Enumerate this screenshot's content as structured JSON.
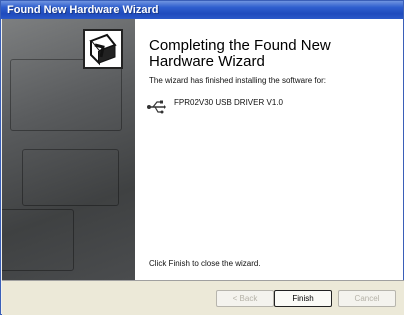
{
  "window": {
    "title": "Found New Hardware Wizard"
  },
  "content": {
    "heading": "Completing the Found New Hardware Wizard",
    "subtitle": "The wizard has finished installing the software for:",
    "device_name": "FPR02V30 USB DRIVER V1.0",
    "finish_hint": "Click Finish to close the wizard."
  },
  "buttons": {
    "back_label": "< Back",
    "finish_label": "Finish",
    "cancel_label": "Cancel"
  },
  "icons": {
    "wizard": "hardware-wizard-icon",
    "device": "usb-icon"
  }
}
